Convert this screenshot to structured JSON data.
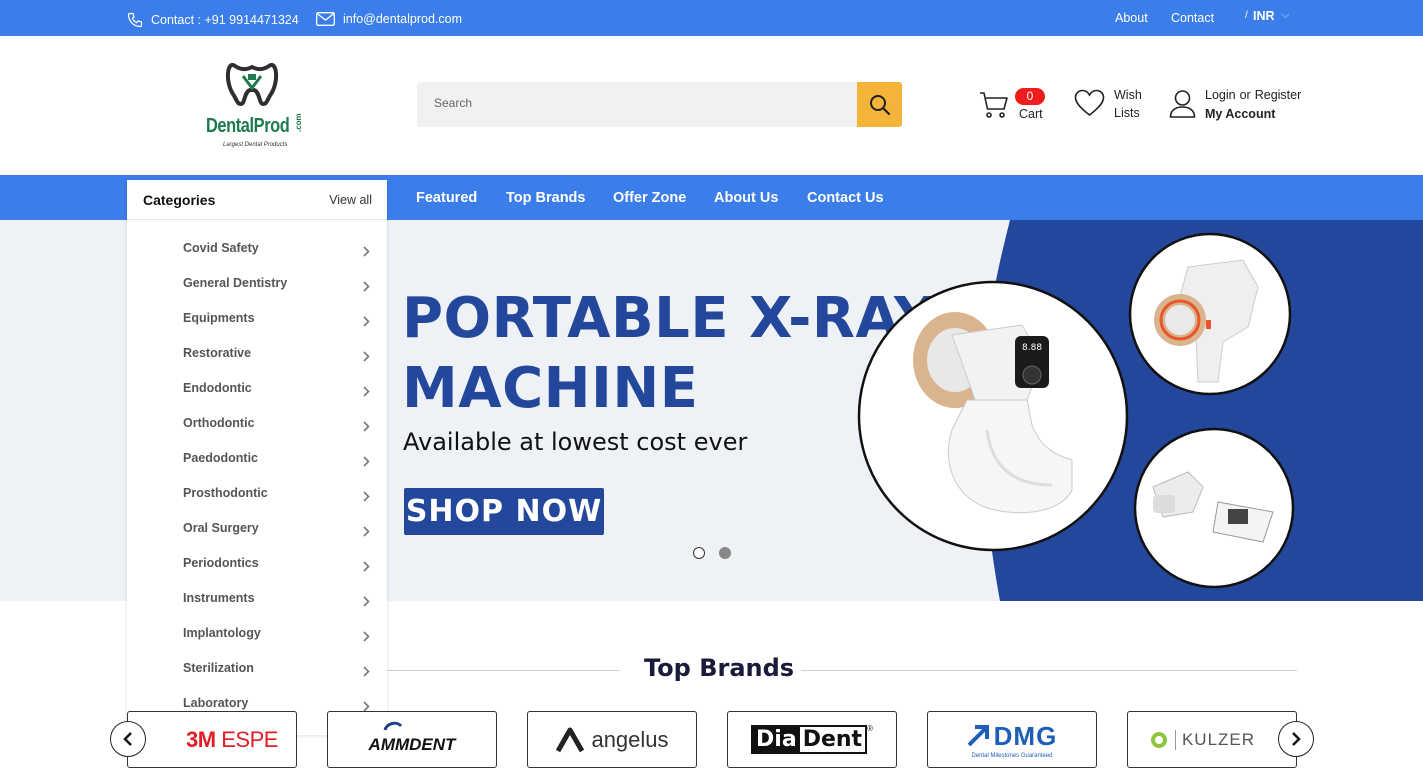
{
  "topbar": {
    "contact_label": "Contact : +91 9914471324",
    "email": "info@dentalprod.com",
    "about": "About",
    "contact": "Contact",
    "separator": "/",
    "currency": "INR"
  },
  "header": {
    "logo_text": "DentalProd",
    "logo_suffix": ".com",
    "logo_tagline": "Largest Dental Products",
    "search_placeholder": "Search",
    "cart_count": "0",
    "cart_label": "Cart",
    "wishlist_line1": "Wish",
    "wishlist_line2": "Lists",
    "login": "Login",
    "or": "or",
    "register": "Register",
    "my_account": "My Account"
  },
  "nav": {
    "items": [
      "Featured",
      "Top Brands",
      "Offer Zone",
      "About Us",
      "Contact Us"
    ]
  },
  "categories": {
    "title": "Categories",
    "view_all": "View all",
    "items": [
      "Covid Safety",
      "General Dentistry",
      "Equipments",
      "Restorative",
      "Endodontic",
      "Orthodontic",
      "Paedodontic",
      "Prosthodontic",
      "Oral Surgery",
      "Periodontics",
      "Instruments",
      "Implantology",
      "Sterilization",
      "Laboratory"
    ]
  },
  "hero": {
    "title_line1": "PORTABLE X-RAY",
    "title_line2": "MACHINE",
    "subtitle": "Available at lowest cost ever",
    "button": "SHOP NOW",
    "device_screen": "8.88",
    "slides": 2,
    "active_slide": 2
  },
  "brands": {
    "title": "Top Brands",
    "items": [
      {
        "name": "3M ESPE"
      },
      {
        "name": "AMMDENT"
      },
      {
        "name": "angelus"
      },
      {
        "name": "DiaDent"
      },
      {
        "name": "DMG",
        "tagline": "Dental Milestones Guaranteed"
      },
      {
        "name": "KULZER"
      }
    ]
  },
  "colors": {
    "primary_blue": "#3b7de9",
    "hero_navy": "#23479a",
    "search_button": "#f4b43a",
    "badge_red": "#ef1d1d",
    "logo_green": "#1f7a4f"
  }
}
